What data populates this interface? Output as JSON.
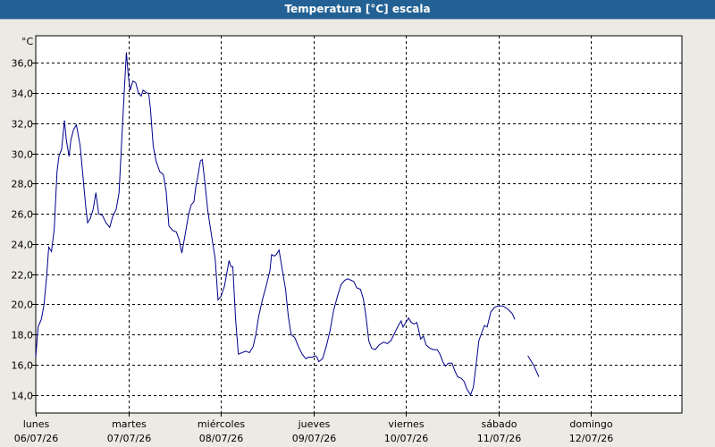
{
  "window": {
    "title": "Temperatura [°C] escala"
  },
  "chart_data": {
    "type": "line",
    "title": "Temperatura [°C] escala",
    "ylabel": "°C",
    "ylim": [
      12.8,
      37.8
    ],
    "xlim": [
      0,
      7.0
    ],
    "yticks": [
      14.0,
      16.0,
      18.0,
      20.0,
      22.0,
      24.0,
      26.0,
      28.0,
      30.0,
      32.0,
      34.0,
      36.0
    ],
    "ytick_labels": [
      "14,0",
      "16,0",
      "18,0",
      "20,0",
      "22,0",
      "24,0",
      "26,0",
      "28,0",
      "30,0",
      "32,0",
      "34,0",
      "36,0"
    ],
    "x_tick_labels": [
      {
        "day": "lunes",
        "date": "06/07/26"
      },
      {
        "day": "martes",
        "date": "07/07/26"
      },
      {
        "day": "miércoles",
        "date": "08/07/26"
      },
      {
        "day": "jueves",
        "date": "09/07/26"
      },
      {
        "day": "viernes",
        "date": "10/07/26"
      },
      {
        "day": "sábado",
        "date": "11/07/26"
      },
      {
        "day": "domingo",
        "date": "12/07/26"
      }
    ],
    "grid": true,
    "line_color": "#00008b",
    "series": [
      {
        "points": [
          [
            0.0,
            16.5
          ],
          [
            0.025,
            18.5
          ],
          [
            0.06,
            19.0
          ],
          [
            0.09,
            20.0
          ],
          [
            0.12,
            22.0
          ],
          [
            0.14,
            23.8
          ],
          [
            0.17,
            23.5
          ],
          [
            0.2,
            25.0
          ],
          [
            0.23,
            28.8
          ],
          [
            0.25,
            29.8
          ],
          [
            0.28,
            30.3
          ],
          [
            0.31,
            32.2
          ],
          [
            0.33,
            30.9
          ],
          [
            0.36,
            29.8
          ],
          [
            0.38,
            30.9
          ],
          [
            0.41,
            31.6
          ],
          [
            0.44,
            31.9
          ],
          [
            0.48,
            30.5
          ],
          [
            0.51,
            28.5
          ],
          [
            0.54,
            26.5
          ],
          [
            0.56,
            25.4
          ],
          [
            0.59,
            25.7
          ],
          [
            0.62,
            26.3
          ],
          [
            0.65,
            27.4
          ],
          [
            0.68,
            26.0
          ],
          [
            0.72,
            25.9
          ],
          [
            0.76,
            25.4
          ],
          [
            0.8,
            25.1
          ],
          [
            0.83,
            25.8
          ],
          [
            0.87,
            26.3
          ],
          [
            0.9,
            27.4
          ],
          [
            0.93,
            31.0
          ],
          [
            0.96,
            34.5
          ],
          [
            0.98,
            36.7
          ],
          [
            1.0,
            35.2
          ],
          [
            1.02,
            34.2
          ],
          [
            1.05,
            34.8
          ],
          [
            1.08,
            34.7
          ],
          [
            1.11,
            34.0
          ],
          [
            1.14,
            33.8
          ],
          [
            1.16,
            34.2
          ],
          [
            1.2,
            34.0
          ],
          [
            1.22,
            34.0
          ],
          [
            1.24,
            33.0
          ],
          [
            1.27,
            30.5
          ],
          [
            1.3,
            29.5
          ],
          [
            1.34,
            28.8
          ],
          [
            1.38,
            28.6
          ],
          [
            1.41,
            27.5
          ],
          [
            1.44,
            25.2
          ],
          [
            1.48,
            24.9
          ],
          [
            1.52,
            24.8
          ],
          [
            1.55,
            24.3
          ],
          [
            1.58,
            23.4
          ],
          [
            1.62,
            24.8
          ],
          [
            1.65,
            25.9
          ],
          [
            1.68,
            26.6
          ],
          [
            1.71,
            26.8
          ],
          [
            1.73,
            27.8
          ],
          [
            1.75,
            28.4
          ],
          [
            1.78,
            29.5
          ],
          [
            1.8,
            29.6
          ],
          [
            1.83,
            28.0
          ],
          [
            1.86,
            26.2
          ],
          [
            1.9,
            24.6
          ],
          [
            1.94,
            23.0
          ],
          [
            1.97,
            20.3
          ],
          [
            2.0,
            20.5
          ],
          [
            2.04,
            21.2
          ],
          [
            2.07,
            22.2
          ],
          [
            2.09,
            22.9
          ],
          [
            2.11,
            22.5
          ],
          [
            2.13,
            22.5
          ],
          [
            2.16,
            19.0
          ],
          [
            2.19,
            16.7
          ],
          [
            2.23,
            16.8
          ],
          [
            2.27,
            16.9
          ],
          [
            2.31,
            16.8
          ],
          [
            2.35,
            17.2
          ],
          [
            2.38,
            18.0
          ],
          [
            2.41,
            19.2
          ],
          [
            2.45,
            20.3
          ],
          [
            2.49,
            21.2
          ],
          [
            2.53,
            22.2
          ],
          [
            2.55,
            23.3
          ],
          [
            2.58,
            23.2
          ],
          [
            2.6,
            23.3
          ],
          [
            2.63,
            23.6
          ],
          [
            2.66,
            22.5
          ],
          [
            2.7,
            21.0
          ],
          [
            2.73,
            19.2
          ],
          [
            2.76,
            18.0
          ],
          [
            2.8,
            17.8
          ],
          [
            2.84,
            17.2
          ],
          [
            2.88,
            16.7
          ],
          [
            2.92,
            16.4
          ],
          [
            2.95,
            16.5
          ],
          [
            2.99,
            16.5
          ],
          [
            3.02,
            16.6
          ],
          [
            3.04,
            16.5
          ],
          [
            3.06,
            16.2
          ],
          [
            3.1,
            16.4
          ],
          [
            3.14,
            17.2
          ],
          [
            3.18,
            18.2
          ],
          [
            3.22,
            19.6
          ],
          [
            3.26,
            20.5
          ],
          [
            3.3,
            21.3
          ],
          [
            3.34,
            21.6
          ],
          [
            3.37,
            21.7
          ],
          [
            3.41,
            21.6
          ],
          [
            3.44,
            21.5
          ],
          [
            3.47,
            21.1
          ],
          [
            3.51,
            21.0
          ],
          [
            3.54,
            20.4
          ],
          [
            3.57,
            19.2
          ],
          [
            3.6,
            17.6
          ],
          [
            3.63,
            17.1
          ],
          [
            3.67,
            17.0
          ],
          [
            3.71,
            17.3
          ],
          [
            3.76,
            17.5
          ],
          [
            3.8,
            17.4
          ],
          [
            3.84,
            17.6
          ],
          [
            3.88,
            18.1
          ],
          [
            3.92,
            18.6
          ],
          [
            3.95,
            18.9
          ],
          [
            3.97,
            18.5
          ],
          [
            4.0,
            18.8
          ],
          [
            4.03,
            19.1
          ],
          [
            4.06,
            18.8
          ],
          [
            4.09,
            18.7
          ],
          [
            4.12,
            18.8
          ],
          [
            4.14,
            18.3
          ],
          [
            4.16,
            17.7
          ],
          [
            4.19,
            17.9
          ],
          [
            4.22,
            17.3
          ],
          [
            4.26,
            17.1
          ],
          [
            4.3,
            17.0
          ],
          [
            4.34,
            17.0
          ],
          [
            4.37,
            16.7
          ],
          [
            4.4,
            16.2
          ],
          [
            4.43,
            15.9
          ],
          [
            4.46,
            16.1
          ],
          [
            4.5,
            16.1
          ],
          [
            4.53,
            15.6
          ],
          [
            4.56,
            15.2
          ],
          [
            4.6,
            15.1
          ],
          [
            4.63,
            14.9
          ],
          [
            4.66,
            14.4
          ],
          [
            4.7,
            14.0
          ],
          [
            4.73,
            14.5
          ],
          [
            4.76,
            16.0
          ],
          [
            4.79,
            17.6
          ],
          [
            4.82,
            18.1
          ],
          [
            4.85,
            18.6
          ],
          [
            4.88,
            18.5
          ],
          [
            4.92,
            19.5
          ],
          [
            4.96,
            19.8
          ],
          [
            5.0,
            19.9
          ],
          [
            5.05,
            19.9
          ],
          [
            5.1,
            19.7
          ],
          [
            5.15,
            19.4
          ],
          [
            5.18,
            19.0
          ],
          null,
          [
            5.32,
            16.6
          ],
          [
            5.38,
            16.0
          ],
          [
            5.44,
            15.2
          ]
        ]
      }
    ]
  }
}
